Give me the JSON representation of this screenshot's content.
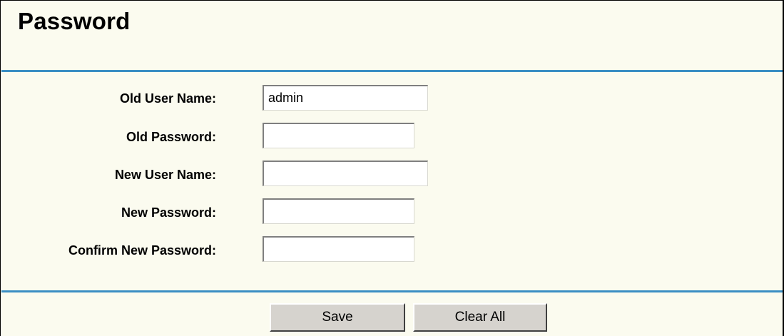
{
  "page": {
    "title": "Password"
  },
  "form": {
    "fields": [
      {
        "label": "Old User Name:",
        "value": "admin",
        "type": "text"
      },
      {
        "label": "Old Password:",
        "value": "",
        "type": "password"
      },
      {
        "label": "New User Name:",
        "value": "",
        "type": "text"
      },
      {
        "label": "New Password:",
        "value": "",
        "type": "password"
      },
      {
        "label": "Confirm New Password:",
        "value": "",
        "type": "password"
      }
    ]
  },
  "actions": {
    "save_label": "Save",
    "clear_label": "Clear All"
  },
  "colors": {
    "background": "#fbfbef",
    "divider": "#3a8ec3",
    "button_face": "#d6d3ce"
  }
}
